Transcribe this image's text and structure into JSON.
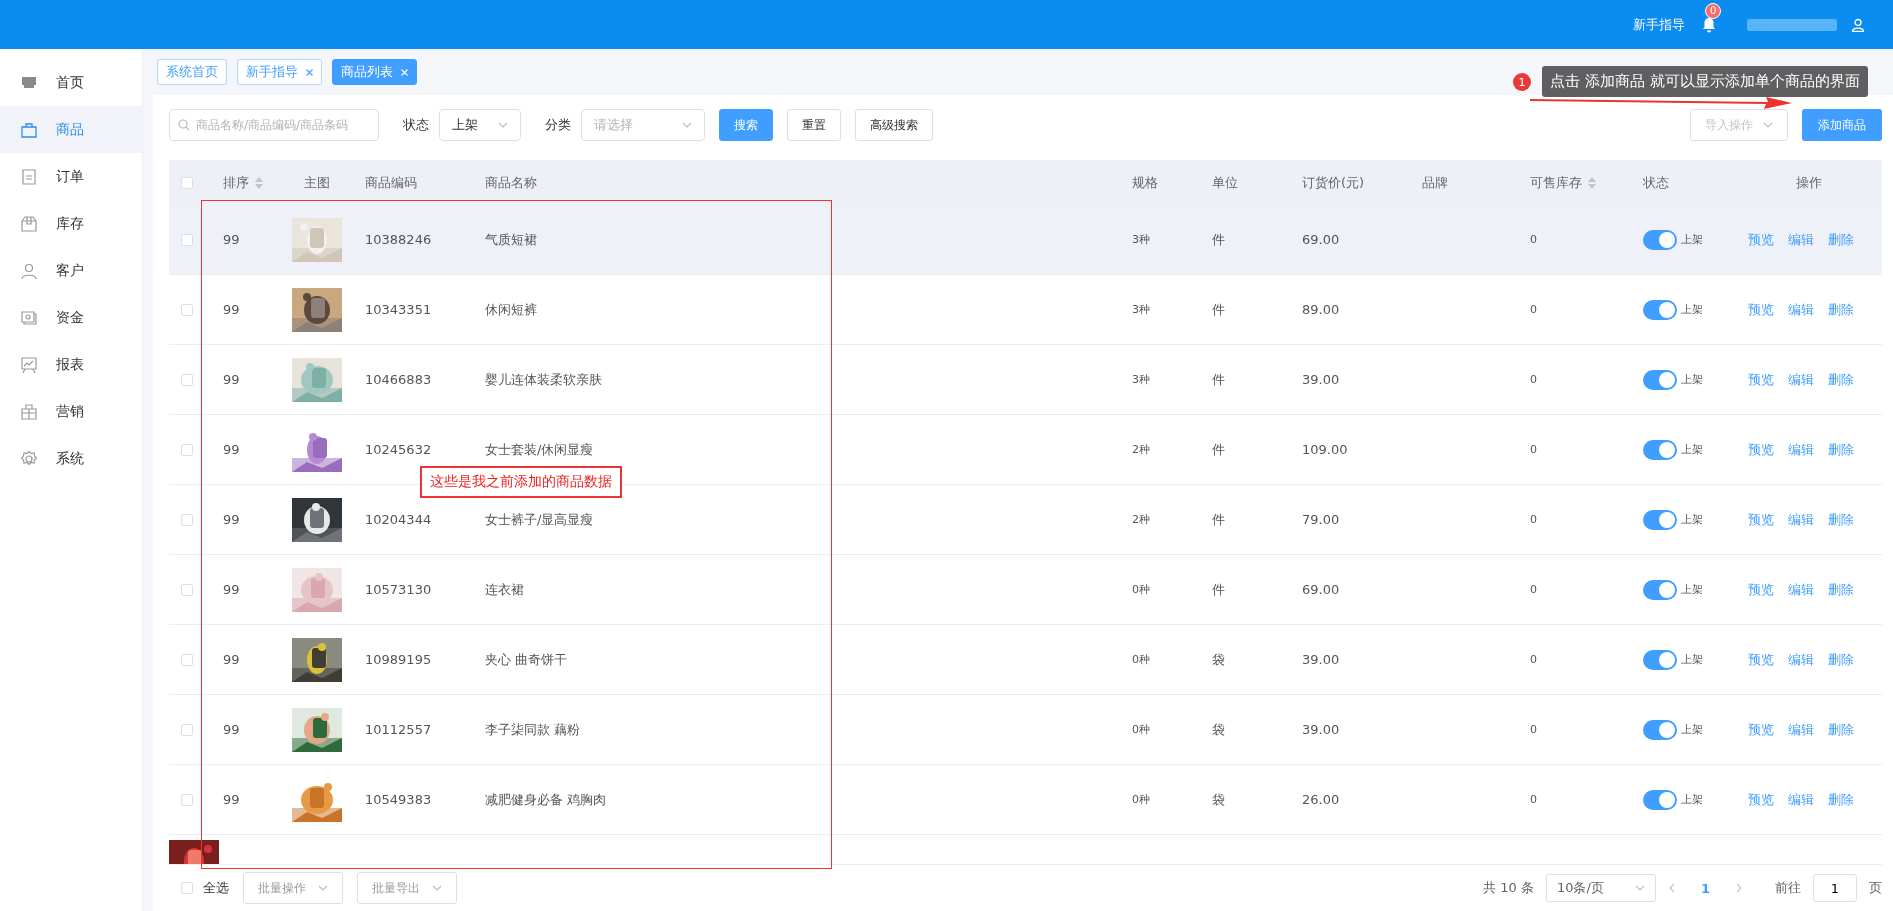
{
  "header": {
    "guide_link": "新手指导",
    "notification_badge": "0"
  },
  "sidebar": {
    "items": [
      {
        "label": "首页",
        "selected": false
      },
      {
        "label": "商品",
        "selected": true
      },
      {
        "label": "订单",
        "selected": false
      },
      {
        "label": "库存",
        "selected": false
      },
      {
        "label": "客户",
        "selected": false
      },
      {
        "label": "资金",
        "selected": false
      },
      {
        "label": "报表",
        "selected": false
      },
      {
        "label": "营销",
        "selected": false
      },
      {
        "label": "系统",
        "selected": false
      }
    ]
  },
  "tabs": [
    {
      "label": "系统首页",
      "selected": false,
      "closable": false
    },
    {
      "label": "新手指导",
      "selected": false,
      "closable": true
    },
    {
      "label": "商品列表",
      "selected": true,
      "closable": true
    }
  ],
  "filters": {
    "search": {
      "placeholder": "商品名称/商品编码/商品条码"
    },
    "status": {
      "label": "状态",
      "value": "上架"
    },
    "category": {
      "label": "分类",
      "placeholder": "请选择"
    },
    "buttons": [
      {
        "label": "搜索",
        "kind": "primary"
      },
      {
        "label": "重置",
        "kind": "default"
      },
      {
        "label": "高级搜索",
        "kind": "default"
      }
    ],
    "import_button": "导入操作",
    "add_button": "添加商品"
  },
  "table": {
    "header_checkbox": {
      "checked": false
    },
    "columns": [
      {
        "label": "排序",
        "sortable": true
      },
      {
        "label": "主图",
        "sortable": false
      },
      {
        "label": "商品编码",
        "sortable": false
      },
      {
        "label": "商品名称",
        "sortable": false
      },
      {
        "label": "规格",
        "sortable": false
      },
      {
        "label": "单位",
        "sortable": false
      },
      {
        "label": "订货价(元)",
        "sortable": false
      },
      {
        "label": "品牌",
        "sortable": false
      },
      {
        "label": "可售库存",
        "sortable": true
      },
      {
        "label": "状态",
        "sortable": false
      },
      {
        "label": "操作",
        "sortable": false
      }
    ],
    "rows": [
      {
        "sort": "99",
        "code": "10388246",
        "name": "气质短裙",
        "spec": "3种",
        "unit": "件",
        "price": "69.00",
        "stock": "0",
        "on": true,
        "status": "上架",
        "actions": [
          "预览",
          "编辑",
          "删除"
        ],
        "selected": true
      },
      {
        "sort": "99",
        "code": "10343351",
        "name": "休闲短裤",
        "spec": "3种",
        "unit": "件",
        "price": "89.00",
        "stock": "0",
        "on": true,
        "status": "上架",
        "actions": [
          "预览",
          "编辑",
          "删除"
        ],
        "selected": false
      },
      {
        "sort": "99",
        "code": "10466883",
        "name": "婴儿连体装柔软亲肤",
        "spec": "3种",
        "unit": "件",
        "price": "39.00",
        "stock": "0",
        "on": true,
        "status": "上架",
        "actions": [
          "预览",
          "编辑",
          "删除"
        ],
        "selected": false
      },
      {
        "sort": "99",
        "code": "10245632",
        "name": "女士套装/休闲显瘦",
        "spec": "2种",
        "unit": "件",
        "price": "109.00",
        "stock": "0",
        "on": true,
        "status": "上架",
        "actions": [
          "预览",
          "编辑",
          "删除"
        ],
        "selected": false
      },
      {
        "sort": "99",
        "code": "10204344",
        "name": "女士裤子/显高显瘦",
        "spec": "2种",
        "unit": "件",
        "price": "79.00",
        "stock": "0",
        "on": true,
        "status": "上架",
        "actions": [
          "预览",
          "编辑",
          "删除"
        ],
        "selected": false
      },
      {
        "sort": "99",
        "code": "10573130",
        "name": "连衣裙",
        "spec": "0种",
        "unit": "件",
        "price": "69.00",
        "stock": "0",
        "on": true,
        "status": "上架",
        "actions": [
          "预览",
          "编辑",
          "删除"
        ],
        "selected": false
      },
      {
        "sort": "99",
        "code": "10989195",
        "name": "夹心 曲奇饼干",
        "spec": "0种",
        "unit": "袋",
        "price": "39.00",
        "stock": "0",
        "on": true,
        "status": "上架",
        "actions": [
          "预览",
          "编辑",
          "删除"
        ],
        "selected": false
      },
      {
        "sort": "99",
        "code": "10112557",
        "name": "李子柒同款 藕粉",
        "spec": "0种",
        "unit": "袋",
        "price": "39.00",
        "stock": "0",
        "on": true,
        "status": "上架",
        "actions": [
          "预览",
          "编辑",
          "删除"
        ],
        "selected": false
      },
      {
        "sort": "99",
        "code": "10549383",
        "name": "减肥健身必备 鸡胸肉",
        "spec": "0种",
        "unit": "袋",
        "price": "26.00",
        "stock": "0",
        "on": true,
        "status": "上架",
        "actions": [
          "预览",
          "编辑",
          "删除"
        ],
        "selected": false
      }
    ]
  },
  "footer": {
    "select_all_checkbox": {
      "checked": false
    },
    "select_all": "全选",
    "bulk_buttons": [
      "批量操作",
      "批量导出"
    ],
    "total": "共 10 条",
    "page_size": "10条/页",
    "current_page": "1",
    "goto_label": "前往",
    "goto_value": "1",
    "page_suffix": "页"
  },
  "annotations": {
    "step_number": "1",
    "tooltip": "点击 添加商品 就可以显示添加单个商品的界面",
    "box_label": "这些是我之前添加的商品数据"
  }
}
